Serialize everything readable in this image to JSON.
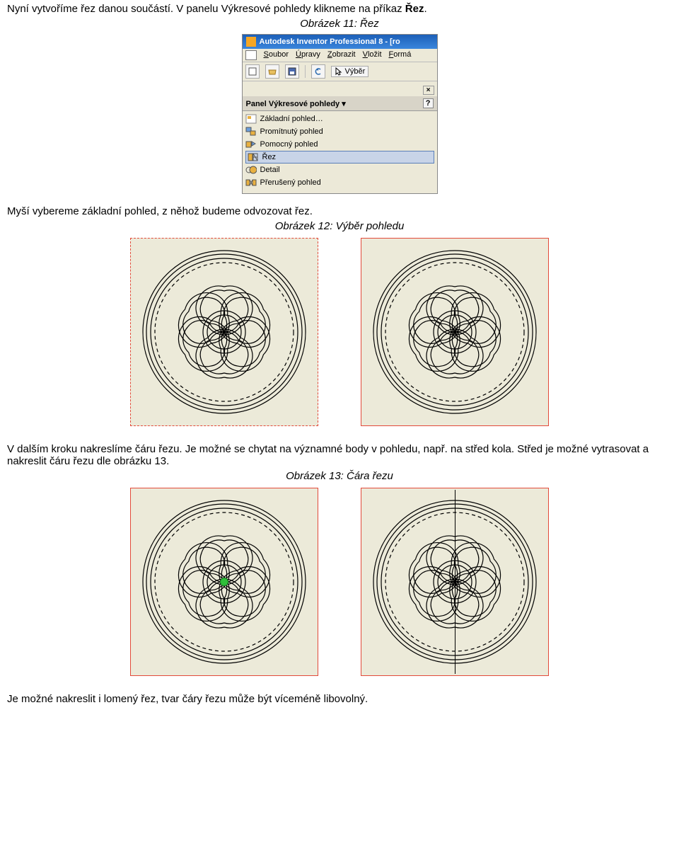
{
  "para1_a": "Nyní vytvoříme řez danou součástí. V panelu Výkresové pohledy klikneme na příkaz ",
  "para1_b": "Řez",
  "para1_c": ".",
  "caption11": "Obrázek 11: Řez",
  "inventor": {
    "title": "Autodesk Inventor Professional 8 - [ro",
    "menu": {
      "file": "Soubor",
      "edit": "Úpravy",
      "view": "Zobrazit",
      "insert": "Vložit",
      "format": "Formá"
    },
    "vyber": "Výběr",
    "panel_title": "Panel Výkresové pohledy ▾",
    "items": {
      "zakladni": "Základní pohled…",
      "promitnuty": "Promítnutý pohled",
      "pomocny": "Pomocný pohled",
      "rez": "Řez",
      "detail": "Detail",
      "preruseny": "Přerušený pohled"
    }
  },
  "para2": "Myší vybereme základní pohled, z něhož budeme odvozovat řez.",
  "caption12": "Obrázek 12: Výběr pohledu",
  "para3": "V dalším kroku nakreslíme čáru řezu. Je možné se chytat na významné body v pohledu, např. na střed kola. Střed je možné vytrasovat a nakreslit čáru řezu dle obrázku 13.",
  "caption13": "Obrázek 13: Čára řezu",
  "para4": "Je možné nakreslit i lomený řez, tvar čáry řezu může být víceméně libovolný."
}
